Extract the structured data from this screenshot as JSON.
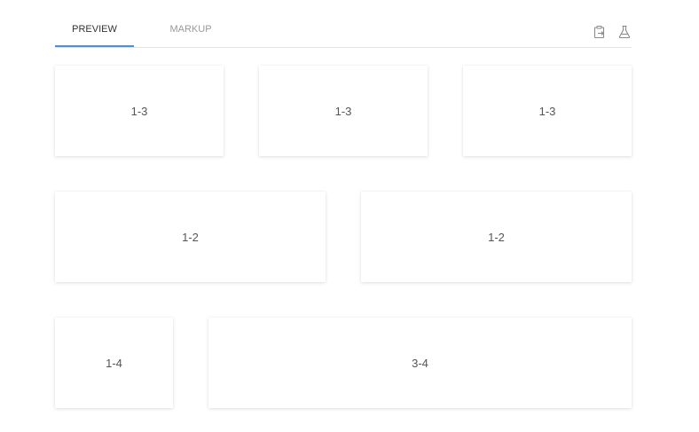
{
  "tabs": {
    "preview_label": "PREVIEW",
    "markup_label": "MARKUP"
  },
  "toolbar": {
    "icons": [
      "copy-to-clipboard-icon",
      "flask-icon"
    ]
  },
  "colors": {
    "accent": "#4a8df0",
    "divider": "#e3e3e3",
    "card_text": "#555555"
  },
  "grid": {
    "row1": [
      "1-3",
      "1-3",
      "1-3"
    ],
    "row2": [
      "1-2",
      "1-2"
    ],
    "row3": [
      "1-4",
      "3-4"
    ]
  }
}
